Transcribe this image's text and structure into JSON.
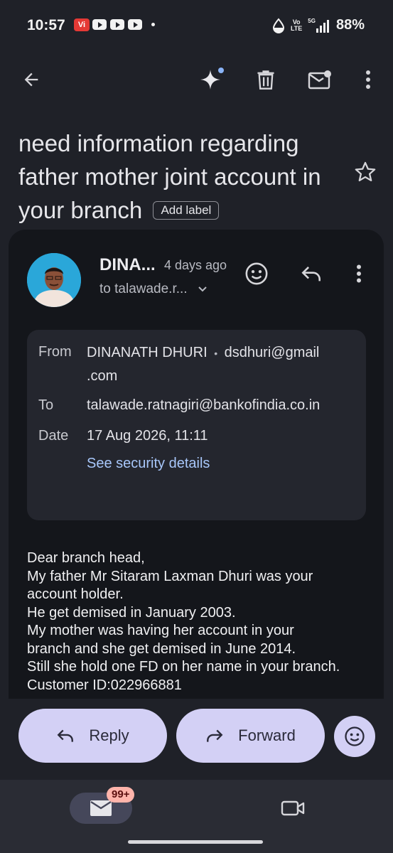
{
  "status": {
    "time": "10:57",
    "carrier_badge": "Vi",
    "network_top": "Vo",
    "network_bottom": "LTE",
    "net_gen": "5G",
    "battery": "88%"
  },
  "subject": {
    "text": "need information regarding father mother joint account in your branch",
    "add_label": "Add label"
  },
  "message": {
    "sender_short": "DINA...",
    "when": "4 days ago",
    "to_short": "to talawade.r...",
    "details": {
      "from_label": "From",
      "from_name": "DINANATH DHURI",
      "from_sep": "•",
      "from_email_1": "dsdhuri@gmail",
      "from_email_2": ".com",
      "to_label": "To",
      "to_value": "talawade.ratnagiri@bankofindia.co.in",
      "date_label": "Date",
      "date_value": "17 Aug 2026, 11:11",
      "security_link": "See security details"
    },
    "body_lines": [
      "Dear branch head,",
      "My father Mr Sitaram Laxman Dhuri was your",
      "account holder.",
      "He get demised in January 2003.",
      "My mother was having her account in your",
      "branch and she get demised in June 2014.",
      "Still she hold one FD on her name in your branch.",
      "Customer ID:022966881"
    ]
  },
  "actions": {
    "reply": "Reply",
    "forward": "Forward"
  },
  "nav": {
    "badge": "99+"
  },
  "colors": {
    "background": "#1f2128",
    "card": "#14161b",
    "pill": "#d3d0f5",
    "link": "#a8c7fa",
    "badge": "#ffb4ab"
  }
}
